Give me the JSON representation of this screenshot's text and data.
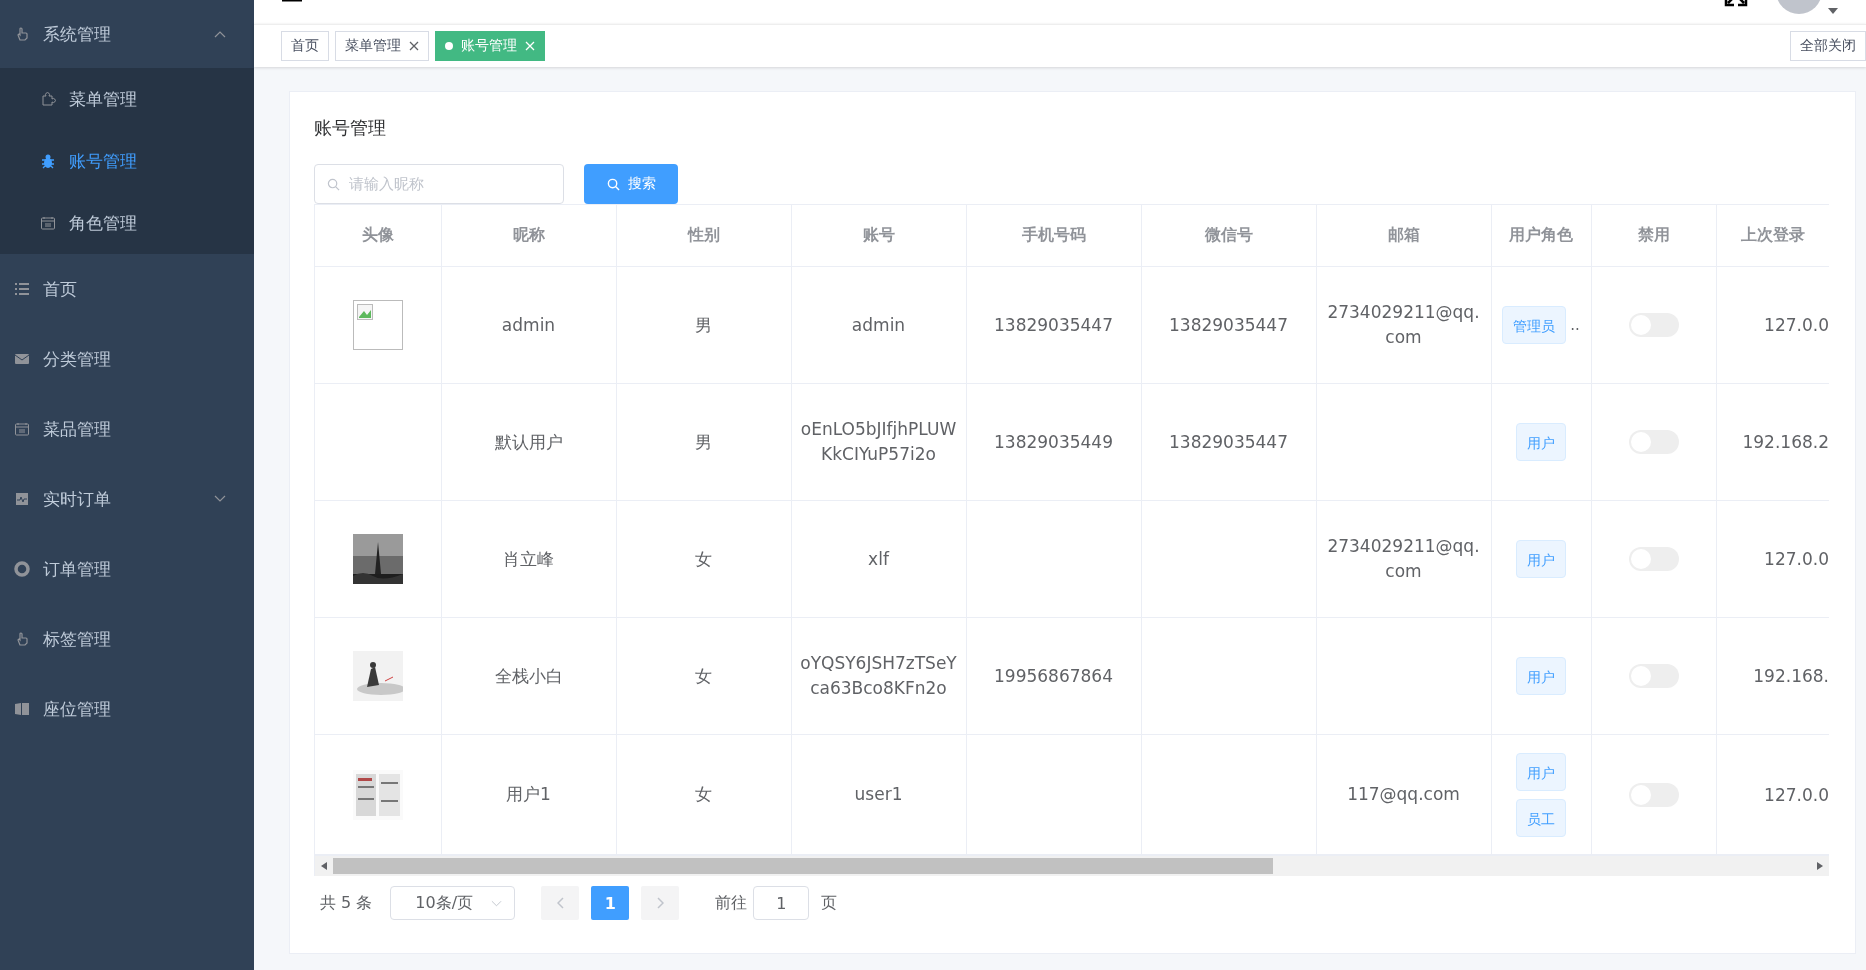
{
  "sidebar": {
    "items": [
      {
        "label": "系统管理",
        "expanded": true,
        "children": [
          {
            "label": "菜单管理",
            "selected": false
          },
          {
            "label": "账号管理",
            "selected": true
          },
          {
            "label": "角色管理",
            "selected": false
          }
        ]
      },
      {
        "label": "首页"
      },
      {
        "label": "分类管理"
      },
      {
        "label": "菜品管理"
      },
      {
        "label": "实时订单",
        "expanded": false
      },
      {
        "label": "订单管理"
      },
      {
        "label": "标签管理"
      },
      {
        "label": "座位管理"
      }
    ]
  },
  "tabs": [
    {
      "label": "首页",
      "selected": false,
      "closable": false
    },
    {
      "label": "菜单管理",
      "selected": false,
      "closable": true
    },
    {
      "label": "账号管理",
      "selected": true,
      "closable": true
    }
  ],
  "close_all": "全部关闭",
  "card": {
    "title": "账号管理",
    "search": {
      "placeholder": "请输入昵称",
      "button": "搜索"
    }
  },
  "table": {
    "columns": [
      "头像",
      "昵称",
      "性别",
      "账号",
      "手机号码",
      "微信号",
      "邮箱",
      "用户角色",
      "禁用",
      "上次登录"
    ],
    "rows": [
      {
        "avatar": {
          "kind": "broken"
        },
        "nickname": "admin",
        "gender": "男",
        "account": "admin",
        "phone": "13829035447",
        "wechat": "13829035447",
        "email": "2734029211@qq.com",
        "roles": [
          "管理员"
        ],
        "roles_more": "..",
        "disabled": false,
        "last_login": "127.0.0"
      },
      {
        "nickname": "默认用户",
        "gender": "男",
        "account": "oEnLO5bJIfjhPLUWKkCIYuP57i2o",
        "phone": "13829035449",
        "wechat": "13829035447",
        "roles": [
          "用户"
        ],
        "disabled": false,
        "last_login": "192.168.2"
      },
      {
        "avatar": {
          "kind": "picture"
        },
        "nickname": "肖立峰",
        "gender": "女",
        "account": "xlf",
        "email": "2734029211@qq.com",
        "roles": [
          "用户"
        ],
        "disabled": false,
        "last_login": "127.0.0"
      },
      {
        "avatar": {
          "kind": "picture"
        },
        "nickname": "全栈小白",
        "gender": "女",
        "account": "oYQSY6JSH7zTSeYca63Bco8KFn2o",
        "phone": "19956867864",
        "roles": [
          "用户"
        ],
        "disabled": false,
        "last_login": "192.168."
      },
      {
        "avatar": {
          "kind": "picture"
        },
        "nickname": "用户1",
        "gender": "女",
        "account": "user1",
        "email": "117@qq.com",
        "roles": [
          "用户",
          "员工"
        ],
        "disabled": false,
        "last_login": "127.0.0"
      }
    ]
  },
  "pagination": {
    "total": "共 5 条",
    "page_size": "10条/页",
    "pages": [
      {
        "label": "1",
        "selected": true
      }
    ],
    "goto_label": "前往",
    "goto_value": "1",
    "goto_suffix": "页"
  }
}
